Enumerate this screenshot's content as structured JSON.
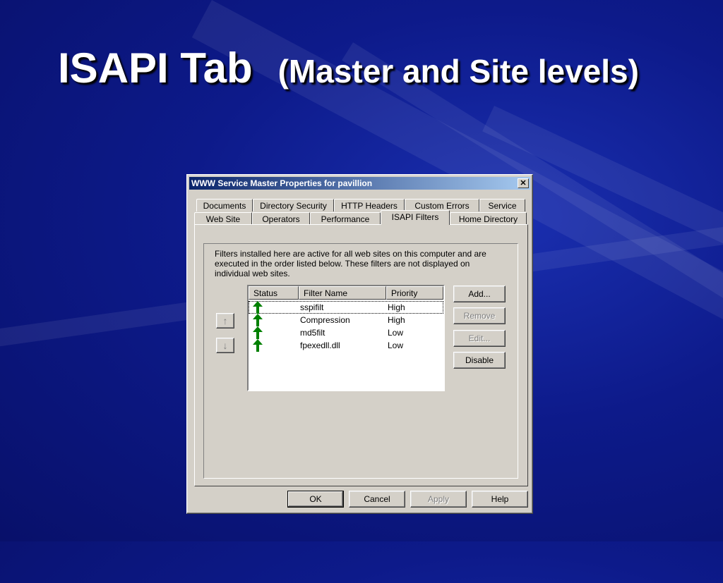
{
  "slide": {
    "title_bold": "ISAPI Tab",
    "title_sub": "(Master and Site levels)"
  },
  "dialog": {
    "title": "WWW Service Master Properties for pavillion",
    "close_label": "✕",
    "tabs_row1": [
      "Documents",
      "Directory Security",
      "HTTP Headers",
      "Custom Errors",
      "Service"
    ],
    "tabs_row2": [
      "Web Site",
      "Operators",
      "Performance",
      "ISAPI Filters",
      "Home Directory"
    ],
    "active_tab": "ISAPI Filters",
    "description": "Filters installed here are active for all web sites on this computer and are executed in the order listed below.  These filters are not displayed on individual web sites.",
    "move_up_label": "↑",
    "move_down_label": "↓",
    "columns": [
      "Status",
      "Filter Name",
      "Priority"
    ],
    "filters": [
      {
        "status_icon": "green-up-arrow-icon",
        "name": "sspifilt",
        "priority": "High"
      },
      {
        "status_icon": "green-up-arrow-icon",
        "name": "Compression",
        "priority": "High"
      },
      {
        "status_icon": "green-up-arrow-icon",
        "name": "md5filt",
        "priority": "Low"
      },
      {
        "status_icon": "green-up-arrow-icon",
        "name": "fpexedll.dll",
        "priority": "Low"
      }
    ],
    "side_buttons": {
      "add": "Add...",
      "remove": "Remove",
      "edit": "Edit...",
      "disable": "Disable"
    },
    "bottom_buttons": {
      "ok": "OK",
      "cancel": "Cancel",
      "apply": "Apply",
      "help": "Help"
    },
    "colors": {
      "status_arrow": "#008000",
      "titlebar_start": "#0a246a",
      "titlebar_end": "#a6caf0"
    }
  }
}
